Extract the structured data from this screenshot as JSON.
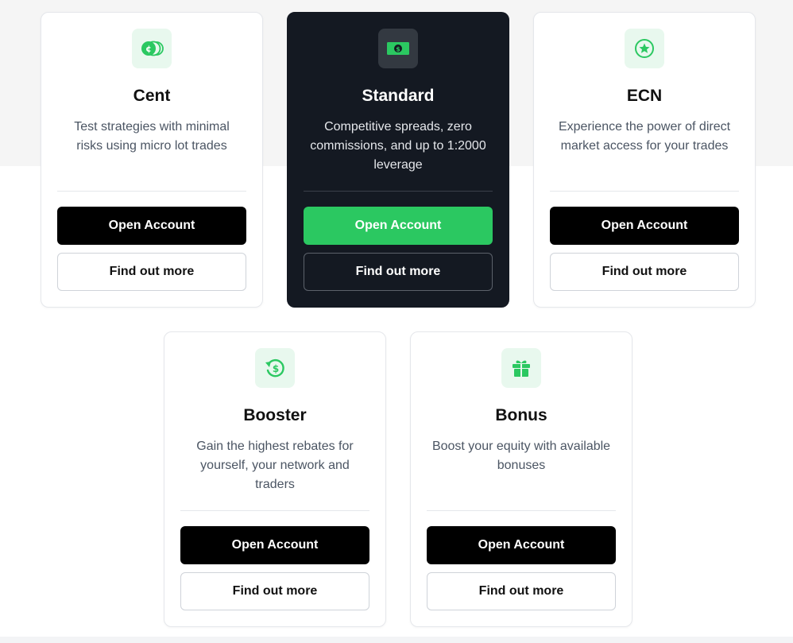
{
  "theme": {
    "accent_green": "#2bc861",
    "dark_card": "#141922",
    "icon_bg_light": "#e8f8ee"
  },
  "accounts": [
    {
      "title": "Cent",
      "description": "Test strategies with minimal risks using micro lot trades",
      "icon": "cent-coins-icon",
      "open_label": "Open Account",
      "more_label": "Find out more",
      "highlighted": false
    },
    {
      "title": "Standard",
      "description": "Competitive spreads, zero commissions, and up to 1:2000 leverage",
      "icon": "banknote-icon",
      "open_label": "Open Account",
      "more_label": "Find out more",
      "highlighted": true
    },
    {
      "title": "ECN",
      "description": "Experience the power of direct market access for your trades",
      "icon": "star-circle-icon",
      "open_label": "Open Account",
      "more_label": "Find out more",
      "highlighted": false
    },
    {
      "title": "Booster",
      "description": "Gain the highest rebates for yourself, your network and traders",
      "icon": "dollar-refresh-icon",
      "open_label": "Open Account",
      "more_label": "Find out more",
      "highlighted": false
    },
    {
      "title": "Bonus",
      "description": "Boost your equity with available bonuses",
      "icon": "gift-icon",
      "open_label": "Open Account",
      "more_label": "Find out more",
      "highlighted": false
    }
  ]
}
